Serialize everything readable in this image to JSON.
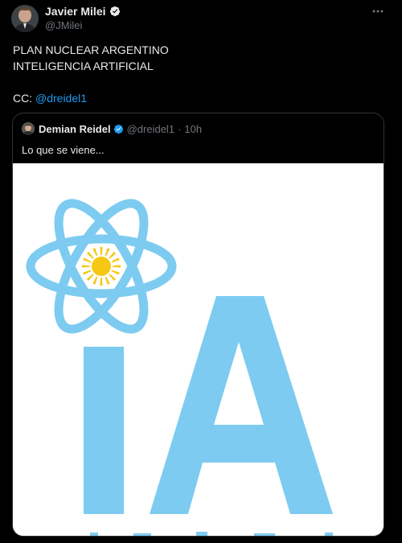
{
  "post": {
    "author_name": "Javier Milei",
    "author_handle": "@JMilei",
    "lines": [
      "PLAN NUCLEAR ARGENTINO",
      "INTELIGENCIA ARTIFICIAL"
    ],
    "cc_prefix": "CC: ",
    "cc_mention": "@dreidel1"
  },
  "quote": {
    "author_name": "Demian Reidel",
    "author_handle": "@dreidel1",
    "dot": "·",
    "time": "10h",
    "text": "Lo que se viene...",
    "image": {
      "logo_text": "IA",
      "primary_color": "#7dcbf0",
      "sun_color": "#f6c813",
      "background": "#ffffff"
    }
  },
  "colors": {
    "background": "#000000",
    "text": "#e7e9ea",
    "secondary": "#71767b",
    "link": "#1d9bf0",
    "verified": "#1d9bf0",
    "border": "#2f3336"
  },
  "icons": {
    "verified": "verified-badge-icon",
    "more": "more-options-icon"
  }
}
